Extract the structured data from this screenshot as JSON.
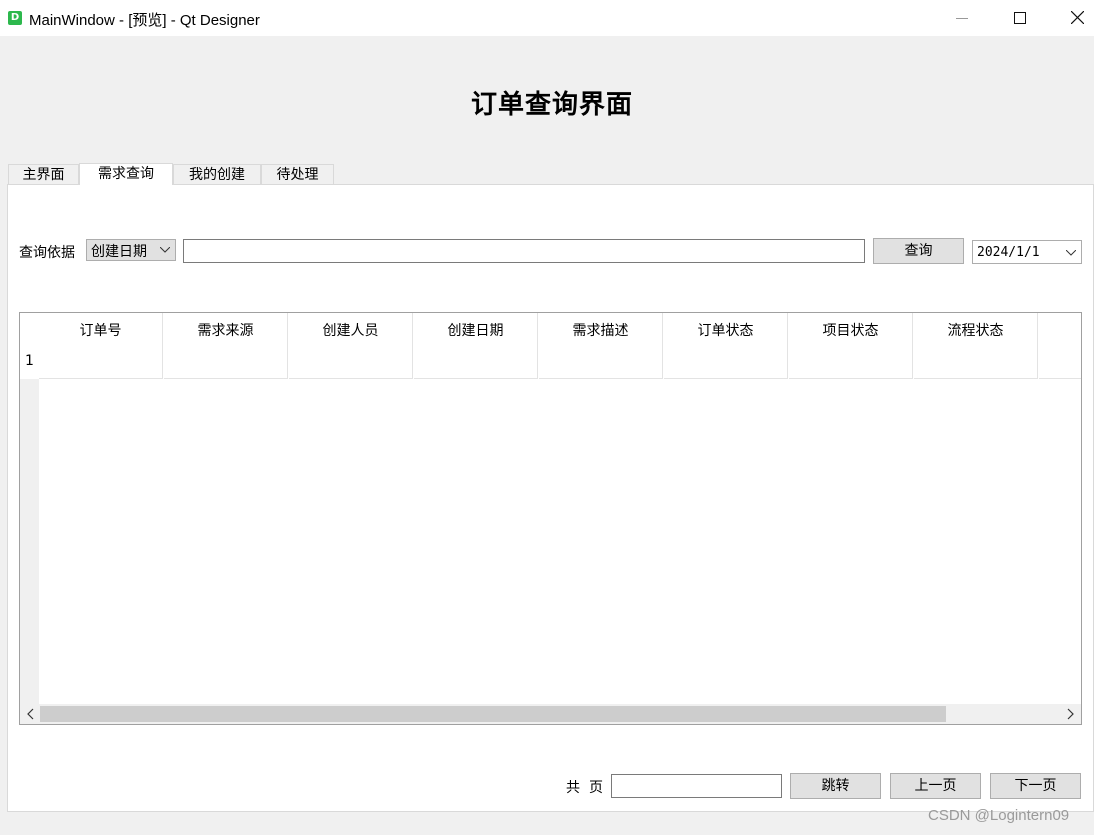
{
  "window": {
    "title": "MainWindow - [预览] - Qt Designer",
    "app_icon_letter": "D",
    "controls": [
      "minimize",
      "maximize",
      "close"
    ]
  },
  "heading": "订单查询界面",
  "tabs": [
    {
      "label": "主界面",
      "active": false
    },
    {
      "label": "需求查询",
      "active": true
    },
    {
      "label": "我的创建",
      "active": false
    },
    {
      "label": "待处理",
      "active": false
    }
  ],
  "query": {
    "criteria_label": "查询依据",
    "criteria_selected": "创建日期",
    "search_value": "",
    "query_button": "查询",
    "date_value": "2024/1/1"
  },
  "table": {
    "columns": [
      "订单号",
      "需求来源",
      "创建人员",
      "创建日期",
      "需求描述",
      "订单状态",
      "项目状态",
      "流程状态"
    ],
    "row_headers": [
      "1"
    ],
    "rows": [
      [
        "",
        "",
        "",
        "",
        "",
        "",
        "",
        ""
      ]
    ]
  },
  "pagination": {
    "total_prefix": "共",
    "total_suffix": "页",
    "page_input_value": "",
    "jump_button": "跳转",
    "prev_button": "上一页",
    "next_button": "下一页"
  },
  "watermark": "CSDN @Logintern09",
  "colors": {
    "background": "#f0f0f0",
    "panel": "#ffffff",
    "button_face": "#e1e1e1",
    "app_icon": "#2db84d"
  }
}
